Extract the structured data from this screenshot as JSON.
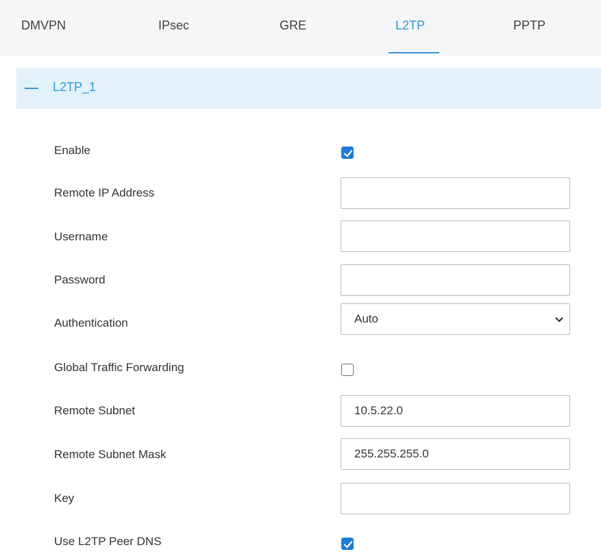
{
  "tabs": [
    {
      "label": "DMVPN",
      "active": false
    },
    {
      "label": "IPsec",
      "active": false
    },
    {
      "label": "GRE",
      "active": false
    },
    {
      "label": "L2TP",
      "active": true
    },
    {
      "label": "PPTP",
      "active": false
    }
  ],
  "section": {
    "title": "L2TP_1",
    "expanded": true
  },
  "form": {
    "enable": {
      "label": "Enable",
      "checked": true
    },
    "remote_ip": {
      "label": "Remote IP Address",
      "value": ""
    },
    "username": {
      "label": "Username",
      "value": ""
    },
    "password": {
      "label": "Password",
      "value": ""
    },
    "authentication": {
      "label": "Authentication",
      "value": "Auto"
    },
    "global_forwarding": {
      "label": "Global Traffic Forwarding",
      "checked": false
    },
    "remote_subnet": {
      "label": "Remote Subnet",
      "value": "10.5.22.0"
    },
    "remote_subnet_mask": {
      "label": "Remote Subnet Mask",
      "value": "255.255.255.0"
    },
    "key": {
      "label": "Key",
      "value": ""
    },
    "peer_dns": {
      "label": "Use L2TP Peer DNS",
      "checked": true
    }
  },
  "colors": {
    "accent": "#2f9ad6",
    "checkbox": "#1f7bd6",
    "section_bg": "#e3f1fa",
    "tabbar_bg": "#f5f6f7"
  },
  "icons": {
    "collapse": "minus-icon",
    "check": "checkmark-icon",
    "dropdown": "chevron-down-icon"
  }
}
